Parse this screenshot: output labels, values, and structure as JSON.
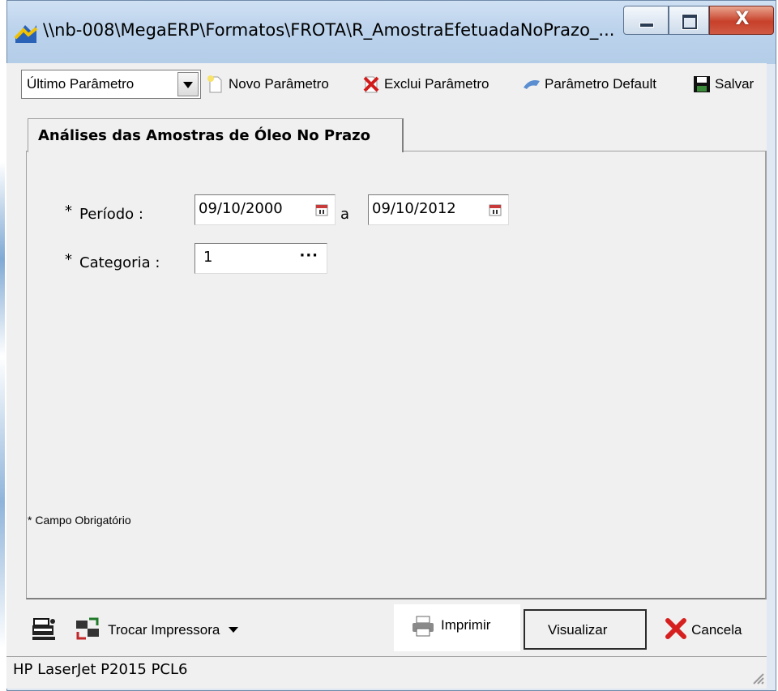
{
  "window": {
    "title": "\\\\nb-008\\MegaERP\\Formatos\\FROTA\\R_AmostraEfetuadaNoPrazo_..."
  },
  "toolbar": {
    "combo_value": "Último Parâmetro",
    "new_label": "Novo Parâmetro",
    "delete_label": "Exclui Parâmetro",
    "default_label": "Parâmetro Default",
    "save_label": "Salvar"
  },
  "tab": {
    "label": "Análises das Amostras de Óleo No Prazo"
  },
  "form": {
    "periodo_label": "Período :",
    "periodo_from": "09/10/2000",
    "periodo_sep": "a",
    "periodo_to": "09/10/2012",
    "categoria_label": "Categoria :",
    "categoria_value": "1",
    "required_marker": "*",
    "required_note": "Campo Obrigatório"
  },
  "bottom": {
    "trocar_label": "Trocar Impressora",
    "imprimir_label": "Imprimir",
    "visualizar_label": "Visualizar",
    "cancela_label": "Cancela"
  },
  "status": {
    "printer": "HP LaserJet P2015 PCL6"
  },
  "icons": {
    "app": "app-icon",
    "minimize": "minimize-icon",
    "maximize": "maximize-icon",
    "close": "close-icon",
    "new": "new-document-icon",
    "delete": "delete-icon",
    "default": "default-arrow-icon",
    "save": "floppy-icon",
    "calendar": "calendar-icon",
    "printer_setup": "printer-setup-icon",
    "swap_printer": "swap-printer-icon",
    "print": "printer-icon",
    "cancel": "red-x-icon"
  }
}
